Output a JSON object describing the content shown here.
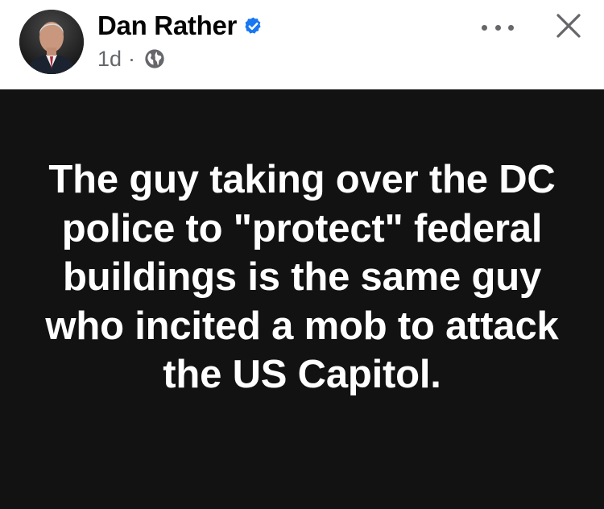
{
  "post": {
    "author": {
      "name": "Dan Rather",
      "verified": true,
      "avatar": "profile-photo"
    },
    "meta": {
      "time": "1d",
      "separator": "·",
      "audience_icon": "globe-icon"
    },
    "actions": {
      "more_icon": "more-options-icon",
      "close_icon": "close-icon"
    },
    "text": "The guy taking over the DC police to \"protect\" federal buildings is the same guy who incited a mob to attack the US Capitol.",
    "colors": {
      "verified_badge": "#1877f2",
      "content_background": "#121212",
      "content_text": "#ffffff",
      "secondary_text": "#65676b"
    }
  }
}
